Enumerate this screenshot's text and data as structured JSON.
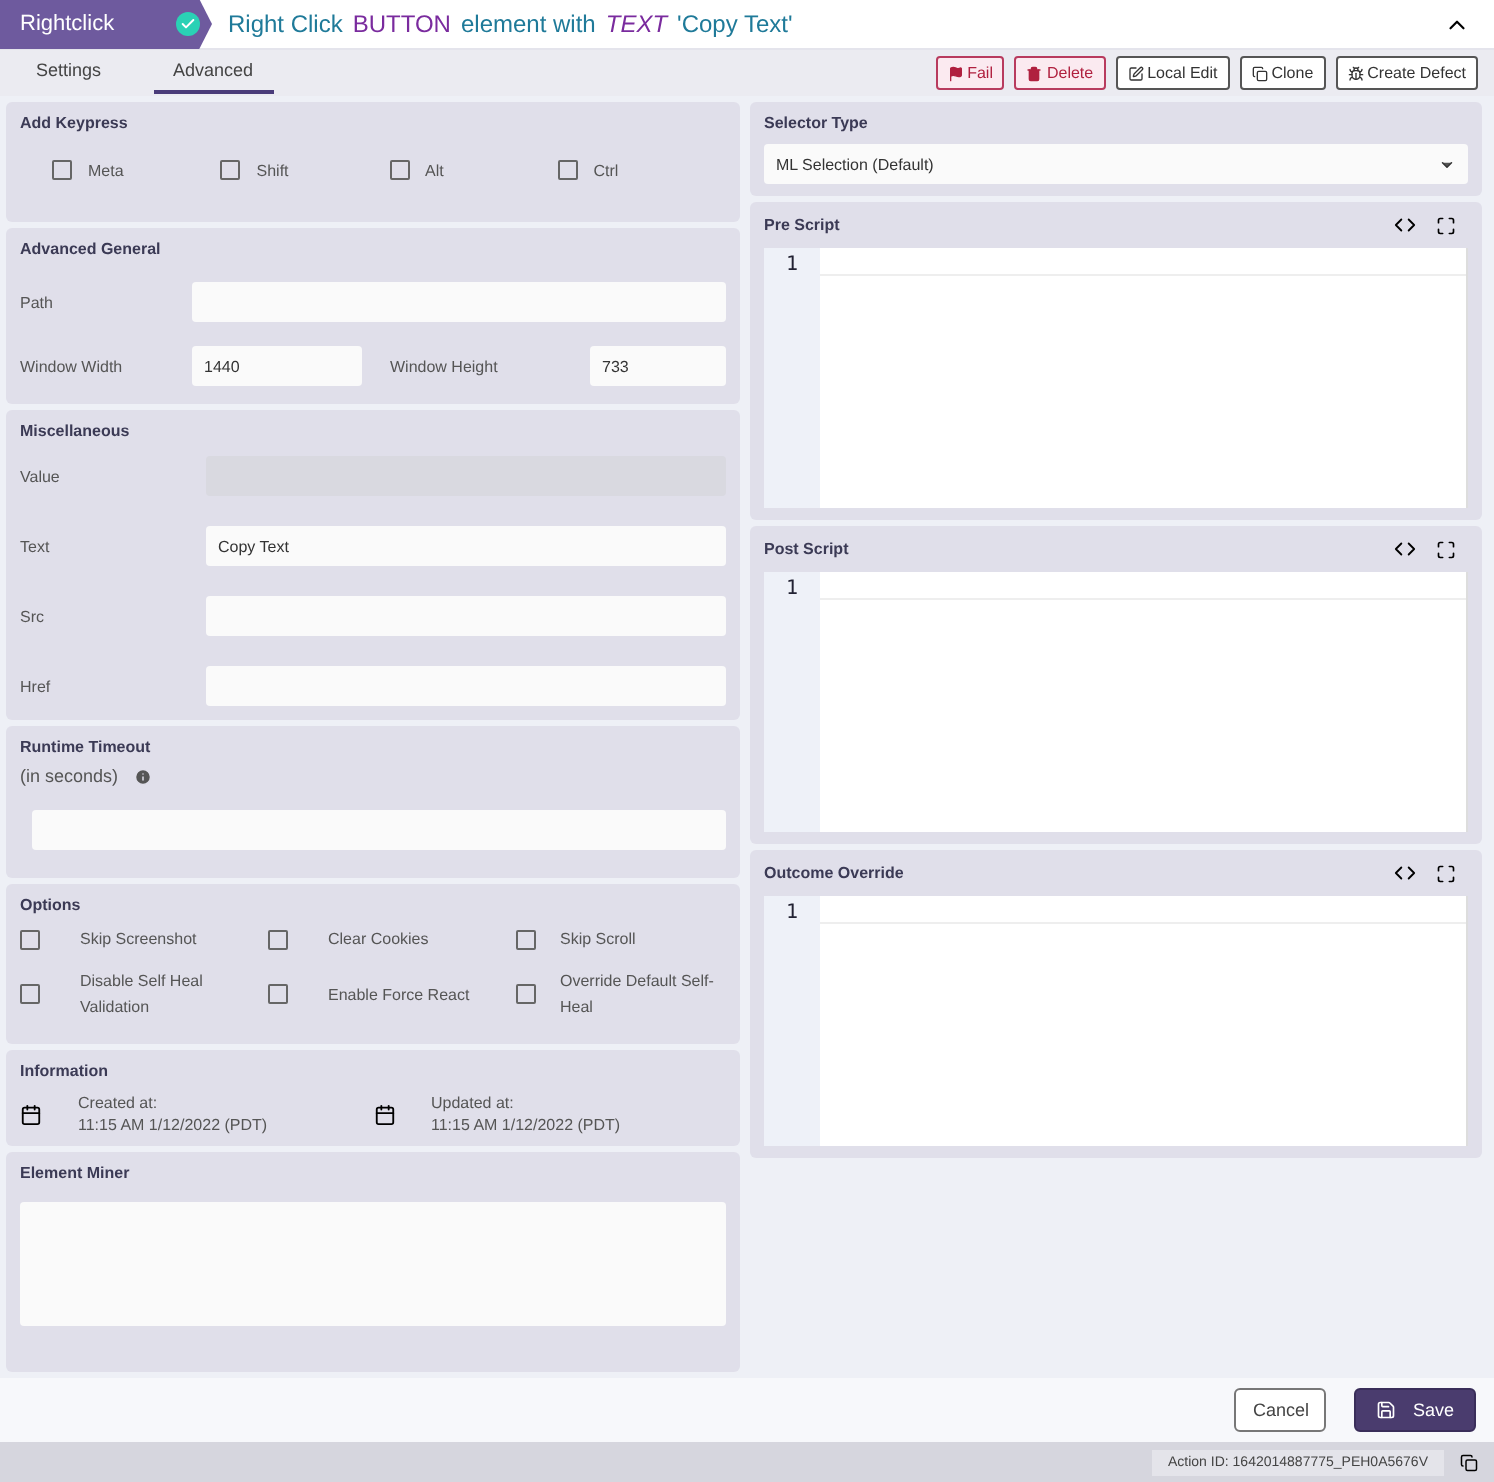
{
  "header": {
    "badge": "Rightclick",
    "badge_done": true,
    "title_parts": [
      {
        "kind": "plain",
        "text": "Right Click"
      },
      {
        "kind": "keyword",
        "text": "BUTTON"
      },
      {
        "kind": "plain",
        "text": "element with"
      },
      {
        "kind": "type",
        "text": "TEXT"
      },
      {
        "kind": "plain",
        "text": "'Copy Text'"
      }
    ]
  },
  "tabs": [
    {
      "label": "Settings",
      "selected": false
    },
    {
      "label": "Advanced",
      "selected": true
    }
  ],
  "actions": [
    {
      "kind": "danger",
      "label": "Fail"
    },
    {
      "kind": "danger",
      "label": "Delete"
    },
    {
      "kind": "plain",
      "label": "Local Edit"
    },
    {
      "kind": "plain",
      "label": "Clone"
    },
    {
      "kind": "plain",
      "label": "Create Defect"
    }
  ],
  "keypress": {
    "title": "Add Keypress",
    "keys": [
      {
        "label": "Meta",
        "checked": false
      },
      {
        "label": "Shift",
        "checked": false
      },
      {
        "label": "Alt",
        "checked": false
      },
      {
        "label": "Ctrl",
        "checked": false
      }
    ]
  },
  "advanced_general": {
    "title": "Advanced General",
    "path": {
      "label": "Path"
    },
    "window_width": {
      "label": "Window Width",
      "value": "1440"
    },
    "window_height": {
      "label": "Window Height",
      "value": "733"
    }
  },
  "miscellaneous": {
    "title": "Miscellaneous",
    "fields": [
      {
        "label": "Value",
        "disabled": true
      },
      {
        "label": "Text",
        "value": "Copy Text",
        "disabled": false
      },
      {
        "label": "Src",
        "disabled": false
      },
      {
        "label": "Href",
        "disabled": false
      }
    ]
  },
  "runtime_timeout": {
    "title": "Runtime Timeout",
    "subtitle": "(in seconds)"
  },
  "options": {
    "title": "Options",
    "items": [
      {
        "label": "Skip Screenshot",
        "checked": false
      },
      {
        "label": "Clear Cookies",
        "checked": false
      },
      {
        "label": "Skip Scroll",
        "checked": false
      },
      {
        "label": "Disable Self Heal Validation",
        "checked": false
      },
      {
        "label": "Enable Force React",
        "checked": false
      },
      {
        "label": "Override Default Self-Heal",
        "checked": false
      }
    ]
  },
  "information": {
    "title": "Information",
    "entries": [
      {
        "label": "Created at:",
        "value": "11:15 AM 1/12/2022 (PDT)"
      },
      {
        "label": "Updated at:",
        "value": "11:15 AM 1/12/2022 (PDT)"
      }
    ]
  },
  "element_miner": {
    "title": "Element Miner"
  },
  "selector_type": {
    "title": "Selector Type",
    "value": "ML Selection (Default)"
  },
  "scripts": [
    {
      "title": "Pre Script",
      "line": "1"
    },
    {
      "title": "Post Script",
      "line": "1"
    },
    {
      "title": "Outcome Override",
      "line": "1"
    }
  ],
  "footer": {
    "cancel": "Cancel",
    "save": "Save"
  },
  "status_bar": {
    "action_id": "Action ID: 1642014887775_PEH0A5676V"
  }
}
